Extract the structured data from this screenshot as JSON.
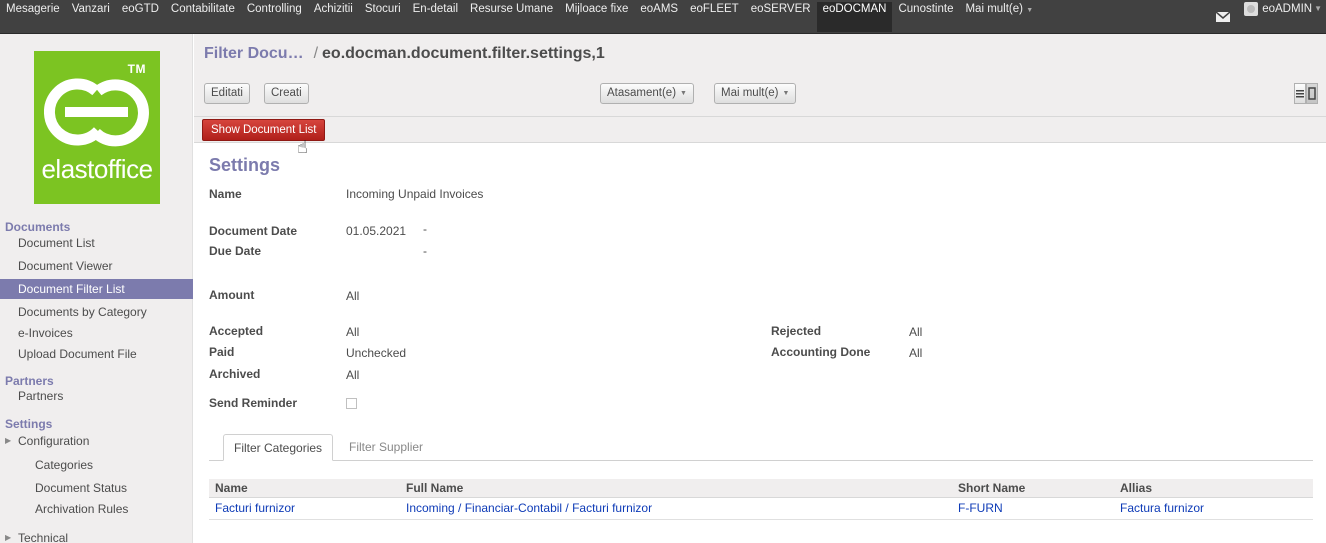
{
  "topbar": {
    "menu": [
      "Mesagerie",
      "Vanzari",
      "eoGTD",
      "Contabilitate",
      "Controlling",
      "Achizitii",
      "Stocuri",
      "En-detail",
      "Resurse Umane",
      "Mijloace fixe",
      "eoAMS",
      "eoFLEET",
      "eoSERVER",
      "eoDOCMAN",
      "Cunostinte",
      "Mai mult(e)"
    ],
    "active": "eoDOCMAN",
    "user": "eoADMIN",
    "mail_icon": "envelope-icon"
  },
  "logo": {
    "tm": "TM",
    "brand": "elastoffice",
    "color": "#7cc422"
  },
  "sidebar": {
    "documents_title": "Documents",
    "documents": [
      "Document List",
      "Document Viewer",
      "Document Filter List",
      "Documents by Category",
      "e-Invoices",
      "Upload Document File"
    ],
    "active_item": "Document Filter List",
    "partners_title": "Partners",
    "partners": [
      "Partners"
    ],
    "settings_title": "Settings",
    "configuration": "Configuration",
    "configuration_items": [
      "Categories",
      "Document Status",
      "Archivation Rules"
    ],
    "technical": "Technical"
  },
  "header": {
    "breadcrumb_parent": "Filter Docu…",
    "separator": "/",
    "breadcrumb_current": "eo.docman.document.filter.settings,1",
    "edit_label": "Editati",
    "create_label": "Creati",
    "attachments_label": "Atasament(e)",
    "more_label": "Mai mult(e)"
  },
  "action": {
    "show_list_label": "Show Document List",
    "accent": "#c0302a"
  },
  "form": {
    "title": "Settings",
    "name_label": "Name",
    "name_value": "Incoming Unpaid Invoices",
    "doc_date_label": "Document Date",
    "doc_date_value": "01.05.2021",
    "doc_date_sep": "-",
    "due_date_label": "Due Date",
    "due_date_sep": "-",
    "amount_label": "Amount",
    "amount_value": "All",
    "accepted_label": "Accepted",
    "accepted_value": "All",
    "paid_label": "Paid",
    "paid_value": "Unchecked",
    "archived_label": "Archived",
    "archived_value": "All",
    "rejected_label": "Rejected",
    "rejected_value": "All",
    "accounting_label": "Accounting Done",
    "accounting_value": "All",
    "reminder_label": "Send Reminder"
  },
  "tabs": [
    "Filter Categories",
    "Filter Supplier"
  ],
  "table": {
    "columns": [
      "Name",
      "Full Name",
      "Short Name",
      "Allias"
    ],
    "rows": [
      [
        "Facturi furnizor",
        "Incoming / Financiar-Contabil / Facturi furnizor",
        "F-FURN",
        "Factura furnizor"
      ]
    ]
  },
  "colors": {
    "topbar": "#414141",
    "accent": "#7c7bad",
    "link": "#0e3bb7"
  }
}
